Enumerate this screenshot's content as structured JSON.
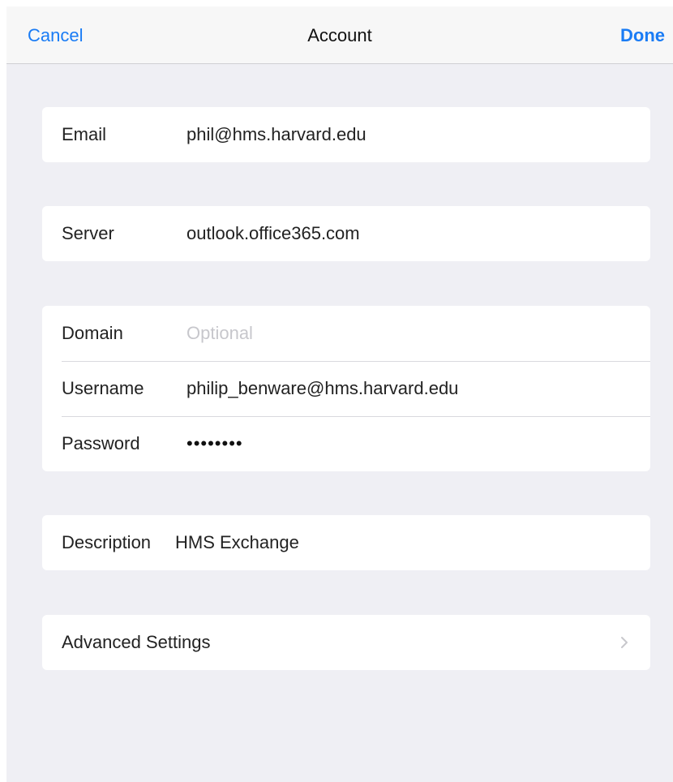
{
  "navbar": {
    "cancel_label": "Cancel",
    "title": "Account",
    "done_label": "Done"
  },
  "email": {
    "label": "Email",
    "value": "phil@hms.harvard.edu"
  },
  "server": {
    "label": "Server",
    "value": "outlook.office365.com"
  },
  "credentials": {
    "domain_label": "Domain",
    "domain_value": "",
    "domain_placeholder": "Optional",
    "username_label": "Username",
    "username_value": "philip_benware@hms.harvard.edu",
    "password_label": "Password",
    "password_masked": "••••••••"
  },
  "description": {
    "label": "Description",
    "value": "HMS Exchange"
  },
  "advanced": {
    "label": "Advanced Settings",
    "icon": "chevron-right-icon"
  },
  "colors": {
    "accent": "#1a7cf5",
    "background": "#efeff4",
    "placeholder": "#c7c7cc"
  }
}
